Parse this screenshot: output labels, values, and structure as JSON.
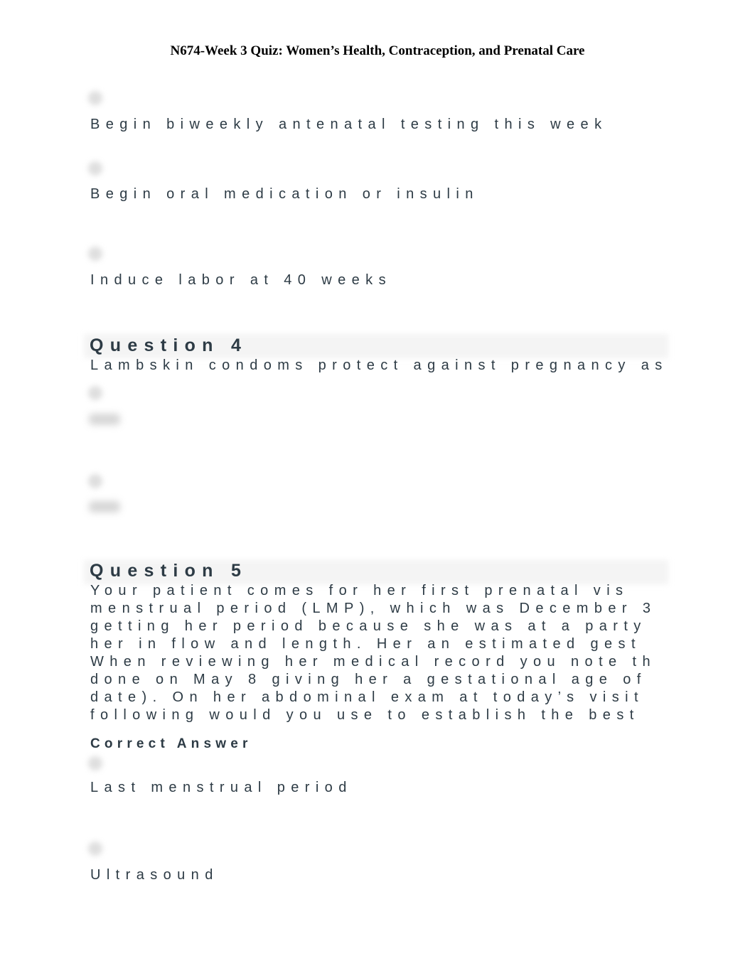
{
  "document": {
    "title": "N674-Week 3 Quiz: Women’s Health, Contraception, and Prenatal Care"
  },
  "question3_options": [
    {
      "label": "Begin biweekly antenatal testing this week"
    },
    {
      "label": "Begin oral medication or insulin"
    },
    {
      "label": "Induce labor at 40 weeks"
    }
  ],
  "question4": {
    "heading": "Question 4",
    "text": "Lambskin condoms protect against pregnancy as",
    "options": [
      {
        "label": "True",
        "blurred": true
      },
      {
        "label": "False",
        "blurred": true
      }
    ]
  },
  "question5": {
    "heading": "Question 5",
    "text_lines": [
      "Your patient comes for her first prenatal vis",
      "menstrual period (LMP), which was December 3",
      "getting her period because she was at a party",
      "her in flow and length. Her an estimated gest",
      "When reviewing her medical record you note th",
      "done on May 8 giving her a gestational age of",
      "date). On her abdominal exam at today’s visit",
      "following would you use to establish the best"
    ],
    "correct_answer_label": "Correct Answer",
    "options": [
      {
        "label": "Last menstrual period",
        "correct": true
      },
      {
        "label": "Ultrasound",
        "correct": false
      }
    ]
  }
}
